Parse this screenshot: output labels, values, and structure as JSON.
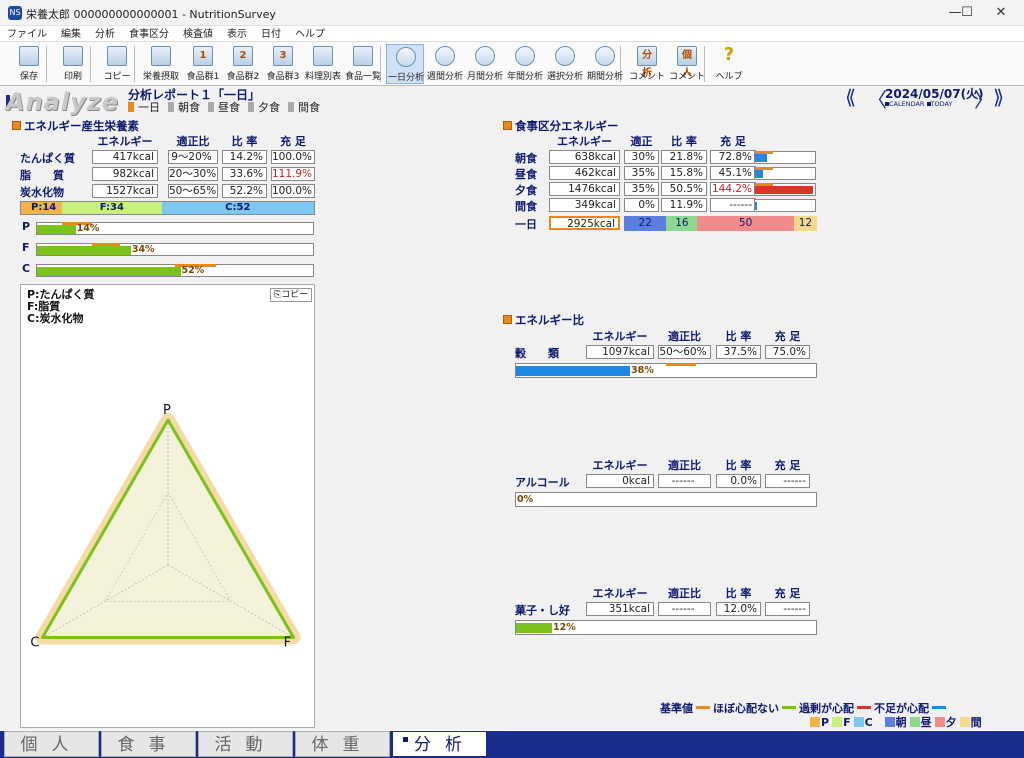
{
  "window": {
    "title": "栄養太郎 000000000000001 - NutritionSurvey",
    "min": "—",
    "max": "☐",
    "close": "✕"
  },
  "menu": [
    "ファイル",
    "編集",
    "分析",
    "食事区分",
    "検査値",
    "表示",
    "日付",
    "ヘルプ"
  ],
  "toolbar": [
    {
      "label": "保存",
      "icon": "save-icon",
      "glyph": ""
    },
    {
      "label": "印刷",
      "icon": "print-icon",
      "glyph": ""
    },
    {
      "label": "コピー",
      "icon": "copy-icon",
      "glyph": ""
    },
    {
      "label": "栄養摂取",
      "icon": "nutrition-intake-icon",
      "glyph": ""
    },
    {
      "label": "食品群1",
      "icon": "food-group-1-icon",
      "glyph": "1"
    },
    {
      "label": "食品群2",
      "icon": "food-group-2-icon",
      "glyph": "2"
    },
    {
      "label": "食品群3",
      "icon": "food-group-3-icon",
      "glyph": "3"
    },
    {
      "label": "料理別表",
      "icon": "dish-table-icon",
      "glyph": ""
    },
    {
      "label": "食品一覧",
      "icon": "food-list-icon",
      "glyph": ""
    },
    {
      "label": "一日分析",
      "icon": "day-analysis-icon",
      "glyph": ""
    },
    {
      "label": "週間分析",
      "icon": "week-analysis-icon",
      "glyph": ""
    },
    {
      "label": "月間分析",
      "icon": "month-analysis-icon",
      "glyph": ""
    },
    {
      "label": "年間分析",
      "icon": "year-analysis-icon",
      "glyph": ""
    },
    {
      "label": "選択分析",
      "icon": "select-analysis-icon",
      "glyph": ""
    },
    {
      "label": "期間分析",
      "icon": "period-analysis-icon",
      "glyph": ""
    },
    {
      "label": "コメント",
      "icon": "comment-icon",
      "glyph": "分析"
    },
    {
      "label": "コメント",
      "icon": "personal-comment-icon",
      "glyph": "個人"
    },
    {
      "label": "ヘルプ",
      "icon": "help-icon",
      "glyph": "?"
    }
  ],
  "header": {
    "logo": "Analyze",
    "report_title": "分析レポート１「一日」",
    "meal_tabs": [
      "一日",
      "朝食",
      "昼食",
      "夕食",
      "間食"
    ],
    "date": "2024/05/07(火)",
    "calendar_label": "CALENDAR",
    "today_label": "TODAY"
  },
  "energy_nutrients": {
    "title": "エネルギー産生栄養素",
    "headers": [
      "エネルギー",
      "適正比",
      "比 率",
      "充 足"
    ],
    "rows": [
      {
        "label": "たんぱく質",
        "energy": "417kcal",
        "range": "9〜20%",
        "ratio": "14.2%",
        "fill": "100.0%",
        "warn": false
      },
      {
        "label": "脂　　質",
        "energy": "982kcal",
        "range": "20〜30%",
        "ratio": "33.6%",
        "fill": "111.9%",
        "warn": true
      },
      {
        "label": "炭水化物",
        "energy": "1527kcal",
        "range": "50〜65%",
        "ratio": "52.2%",
        "fill": "100.0%",
        "warn": false
      }
    ],
    "pfc": [
      {
        "label": "P:14",
        "value": 14
      },
      {
        "label": "F:34",
        "value": 34
      },
      {
        "label": "C:52",
        "value": 52
      }
    ],
    "bars": [
      {
        "label": "P",
        "value": 14,
        "text": "14%",
        "ref_lo": 9,
        "ref_hi": 20
      },
      {
        "label": "F",
        "value": 34,
        "text": "34%",
        "ref_lo": 20,
        "ref_hi": 30
      },
      {
        "label": "C",
        "value": 52,
        "text": "52%",
        "ref_lo": 50,
        "ref_hi": 65
      }
    ],
    "radar_legend": [
      "P:たんぱく質",
      "F:脂質",
      "C:炭水化物"
    ],
    "copy_label": "コピー",
    "axis_labels": [
      "P",
      "F",
      "C"
    ]
  },
  "meal_energy": {
    "title": "食事区分エネルギー",
    "headers": [
      "エネルギー",
      "適正",
      "比 率",
      "充 足"
    ],
    "rows": [
      {
        "label": "朝食",
        "energy": "638kcal",
        "proper": "30%",
        "ratio": "21.8%",
        "fill": "72.8%",
        "value": 72.8,
        "warn": false,
        "over": false
      },
      {
        "label": "昼食",
        "energy": "462kcal",
        "proper": "35%",
        "ratio": "15.8%",
        "fill": "45.1%",
        "value": 45.1,
        "warn": false,
        "over": false
      },
      {
        "label": "夕食",
        "energy": "1476kcal",
        "proper": "35%",
        "ratio": "50.5%",
        "fill": "144.2%",
        "value": 144.2,
        "warn": true,
        "over": true
      },
      {
        "label": "間食",
        "energy": "349kcal",
        "proper": "0%",
        "ratio": "11.9%",
        "fill": "------",
        "value": 10,
        "warn": false,
        "over": false
      }
    ],
    "total": {
      "label": "一日",
      "energy": "2925kcal",
      "split": [
        {
          "text": "22",
          "value": 22
        },
        {
          "text": "16",
          "value": 16
        },
        {
          "text": "50",
          "value": 50
        },
        {
          "text": "12",
          "value": 12
        }
      ]
    }
  },
  "energy_ratio": {
    "title": "エネルギー比",
    "headers": [
      "エネルギー",
      "適正比",
      "比 率",
      "充 足"
    ],
    "items": [
      {
        "label": "穀　　類",
        "energy": "1097kcal",
        "range": "50〜60%",
        "ratio": "37.5%",
        "fill": "75.0%",
        "value": 38,
        "text": "38%",
        "ref_lo": 50,
        "ref_hi": 60,
        "color": "#1e88e5"
      },
      {
        "label": "アルコール",
        "energy": "0kcal",
        "range": "------",
        "ratio": "0.0%",
        "fill": "------",
        "value": 0,
        "text": "0%",
        "ref_lo": null,
        "ref_hi": null,
        "color": "#7cc21c"
      },
      {
        "label": "菓子・し好",
        "energy": "351kcal",
        "range": "------",
        "ratio": "12.0%",
        "fill": "------",
        "value": 12,
        "text": "12%",
        "ref_lo": null,
        "ref_hi": null,
        "color": "#7cc21c"
      }
    ]
  },
  "legend": {
    "line1": [
      {
        "text": "基準値",
        "color": "#e8891c"
      },
      {
        "text": "ほぼ心配ない",
        "color": "#7cc21c"
      },
      {
        "text": "過剰が心配",
        "color": "#e0302a"
      },
      {
        "text": "不足が心配",
        "color": "#1e88e5"
      }
    ],
    "line2": [
      {
        "text": "P",
        "color": "#f2b34a"
      },
      {
        "text": "F",
        "color": "#c8f07a"
      },
      {
        "text": "C",
        "color": "#7cc8f0"
      },
      {
        "text": "朝",
        "color": "#5b7fe0"
      },
      {
        "text": "昼",
        "color": "#8fd88f"
      },
      {
        "text": "夕",
        "color": "#f08c8c"
      },
      {
        "text": "間",
        "color": "#f5d98a"
      }
    ]
  },
  "bottom_tabs": [
    {
      "label": "個人",
      "active": false
    },
    {
      "label": "食事",
      "active": false
    },
    {
      "label": "活動",
      "active": false
    },
    {
      "label": "体重",
      "active": false
    },
    {
      "label": "分析",
      "active": true
    }
  ],
  "colors": {
    "accent": "#0e1a6e",
    "ok": "#7cc21c",
    "over": "#e0302a",
    "under": "#1e88e5",
    "ref": "#e8891c"
  }
}
